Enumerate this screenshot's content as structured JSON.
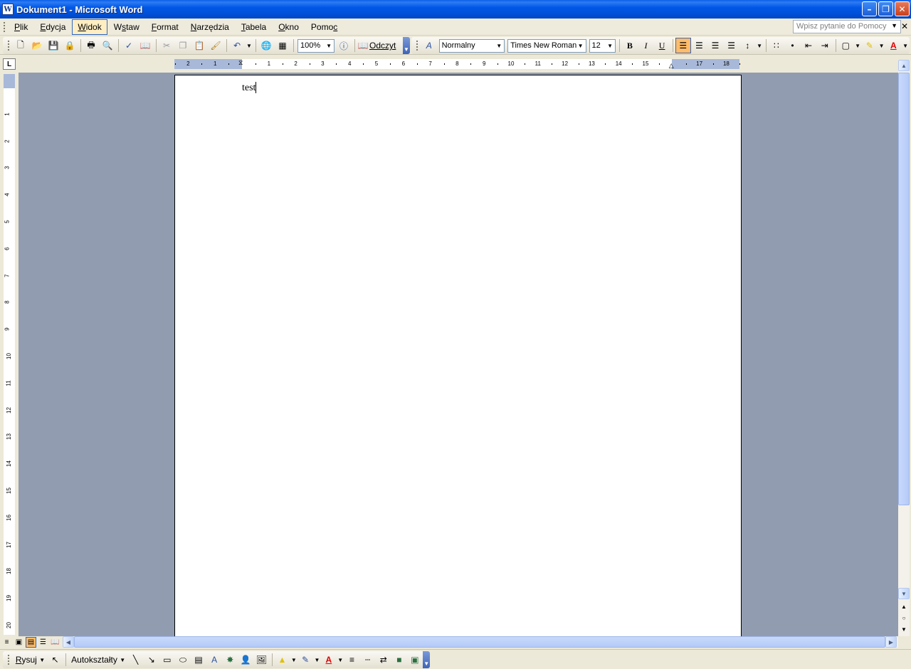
{
  "window": {
    "title": "Dokument1 - Microsoft Word",
    "app_icon": "W"
  },
  "menu": {
    "items": [
      {
        "label": "Plik",
        "ul": "P",
        "rest": "lik"
      },
      {
        "label": "Edycja",
        "ul": "E",
        "rest": "dycja"
      },
      {
        "label": "Widok",
        "ul": "W",
        "rest": "idok"
      },
      {
        "label": "Wstaw",
        "pre": "W",
        "ul": "s",
        "rest": "taw"
      },
      {
        "label": "Format",
        "ul": "F",
        "rest": "ormat"
      },
      {
        "label": "Narzędzia",
        "ul": "N",
        "rest": "arzędzia"
      },
      {
        "label": "Tabela",
        "ul": "T",
        "rest": "abela"
      },
      {
        "label": "Okno",
        "ul": "O",
        "rest": "kno"
      },
      {
        "label": "Pomoc",
        "pre": "Pomo",
        "ul": "c",
        "rest": ""
      }
    ],
    "active": "Widok",
    "help_placeholder": "Wpisz pytanie do Pomocy"
  },
  "toolbar": {
    "zoom": "100%",
    "reading_label": "Odczyt",
    "style": "Normalny",
    "font": "Times New Roman",
    "size": "12",
    "bold": "B",
    "italic": "I",
    "underline": "U"
  },
  "ruler": {
    "h_ticks": [
      "2",
      "1",
      "1",
      "2",
      "3",
      "4",
      "5",
      "6",
      "7",
      "8",
      "9",
      "10",
      "11",
      "12",
      "13",
      "14",
      "15",
      "17",
      "18"
    ],
    "v_ticks": [
      "1",
      "2",
      "3",
      "4",
      "5",
      "6",
      "7",
      "8",
      "9",
      "10",
      "11",
      "12",
      "13",
      "14",
      "15",
      "16",
      "17",
      "18",
      "19",
      "20"
    ],
    "corner": "L"
  },
  "document": {
    "text": "test"
  },
  "drawing": {
    "draw_label": "Rysuj",
    "draw_ul": "R",
    "draw_rest": "ysuj",
    "autoshapes_label": "Autokształty",
    "autoshapes_ul": "u"
  },
  "colors": {
    "accent": "#0058E6",
    "page_bg": "#929CB0",
    "highlight": "#FFEEC2"
  }
}
